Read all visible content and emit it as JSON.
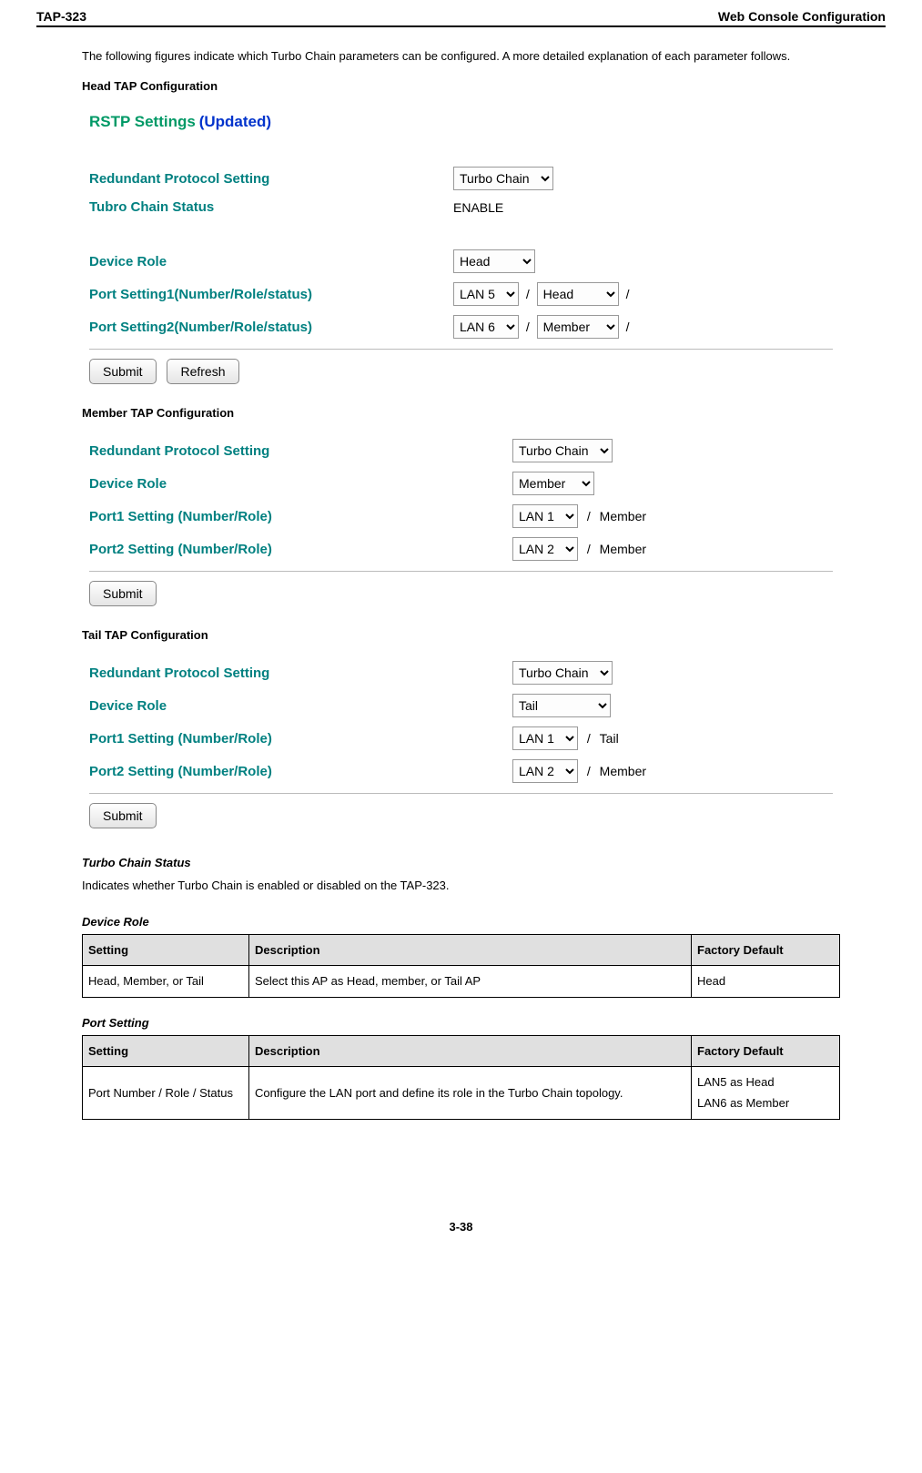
{
  "header": {
    "left": "TAP-323",
    "right": "Web Console Configuration"
  },
  "intro": "The following figures indicate which Turbo Chain parameters can be configured. A more detailed explanation of each parameter follows.",
  "headings": {
    "head_tap": "Head TAP Configuration",
    "member_tap": "Member TAP Configuration",
    "tail_tap": "Tail TAP Configuration",
    "turbo_status": "Turbo Chain Status",
    "device_role": "Device Role",
    "port_setting": "Port Setting"
  },
  "rstp": {
    "label": "RSTP Settings",
    "updated": "(Updated)"
  },
  "labels": {
    "redundant": "Redundant Protocol Setting",
    "tubro_status": "Tubro Chain Status",
    "device_role": "Device Role",
    "port1_nrs": "Port Setting1(Number/Role/status)",
    "port2_nrs": "Port Setting2(Number/Role/status)",
    "port1_nr": "Port1 Setting (Number/Role)",
    "port2_nr": "Port2 Setting (Number/Role)"
  },
  "head": {
    "protocol": "Turbo Chain",
    "status": "ENABLE",
    "role": "Head",
    "port1_num": "LAN 5",
    "port1_role": "Head",
    "port2_num": "LAN 6",
    "port2_role": "Member"
  },
  "member": {
    "protocol": "Turbo Chain",
    "role": "Member",
    "port1_num": "LAN 1",
    "port1_role": "Member",
    "port2_num": "LAN 2",
    "port2_role": "Member"
  },
  "tail": {
    "protocol": "Turbo Chain",
    "role": "Tail",
    "port1_num": "LAN 1",
    "port1_role": "Tail",
    "port2_num": "LAN 2",
    "port2_role": "Member"
  },
  "buttons": {
    "submit": "Submit",
    "refresh": "Refresh"
  },
  "turbo_desc": "Indicates whether Turbo Chain is enabled or disabled on the TAP-323.",
  "table": {
    "cols": {
      "setting": "Setting",
      "description": "Description",
      "default": "Factory Default"
    }
  },
  "device_role_table": {
    "setting": "Head, Member, or Tail",
    "desc": "Select this AP as Head, member, or Tail AP",
    "def": "Head"
  },
  "port_setting_table": {
    "setting": "Port Number / Role / Status",
    "desc": "Configure the LAN port and define its role in the Turbo Chain topology.",
    "def": "LAN5 as Head\nLAN6 as Member"
  },
  "page_number": "3-38"
}
